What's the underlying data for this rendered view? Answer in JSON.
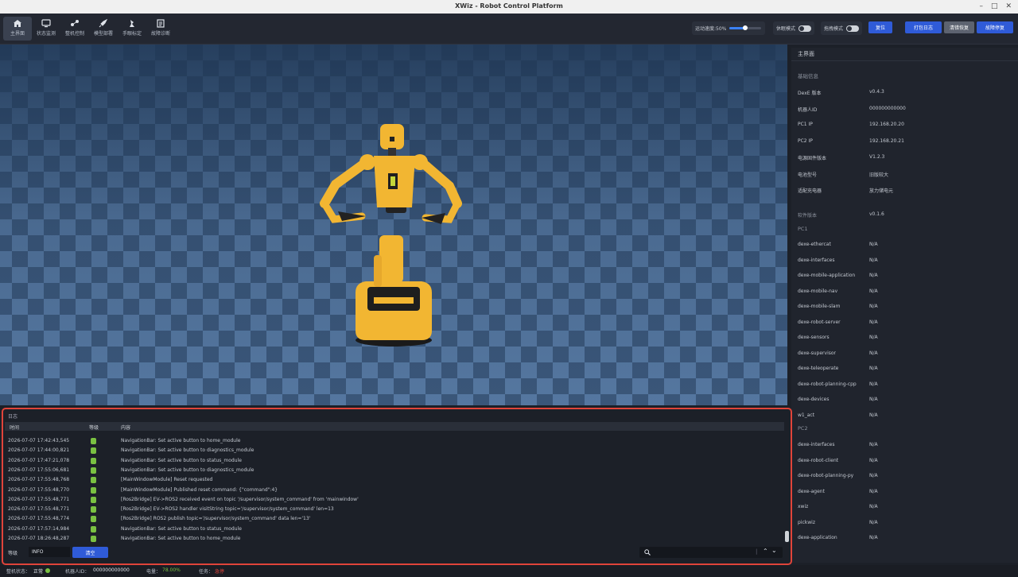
{
  "window": {
    "title": "XWiz - Robot Control Platform"
  },
  "toolbar": {
    "tabs": [
      {
        "label": "主界面",
        "icon": "home-icon"
      },
      {
        "label": "状态监测",
        "icon": "monitor-icon"
      },
      {
        "label": "整机控制",
        "icon": "control-icon"
      },
      {
        "label": "模型部署",
        "icon": "rocket-icon"
      },
      {
        "label": "手眼标定",
        "icon": "calibration-icon"
      },
      {
        "label": "故障诊断",
        "icon": "diagnostics-icon"
      }
    ],
    "speed_label": "运动速度:50%",
    "speed_value": 0.5,
    "sleep_mode_label": "休眠模式",
    "drag_mode_label": "拖拽模式",
    "reset_label": "复位",
    "pack_log_label": "打包日志",
    "clear_error_label": "清错恢复",
    "fault_stop_label": "故障停复"
  },
  "right_panel": {
    "header": "主界面",
    "basic_section": "基础信息",
    "basic": [
      {
        "k": "DexE 版本",
        "v": "v0.4.3"
      },
      {
        "k": "机器人ID",
        "v": "000000000000"
      },
      {
        "k": "PC1 IP",
        "v": "192.168.20.20"
      },
      {
        "k": "PC2 IP",
        "v": "192.168.20.21"
      },
      {
        "k": "电源固件版本",
        "v": "V1.2.3"
      },
      {
        "k": "电池型号",
        "v": "旧版较大"
      },
      {
        "k": "适配充电器",
        "v": "放力储电元"
      }
    ],
    "software_label": "软件版本",
    "software_value": "v0.1.6",
    "pc1_label": "PC1",
    "pc1": [
      {
        "k": "dexe-ethercat",
        "v": "N/A"
      },
      {
        "k": "dexe-interfaces",
        "v": "N/A"
      },
      {
        "k": "dexe-mobile-application",
        "v": "N/A"
      },
      {
        "k": "dexe-mobile-nav",
        "v": "N/A"
      },
      {
        "k": "dexe-mobile-slam",
        "v": "N/A"
      },
      {
        "k": "dexe-robot-server",
        "v": "N/A"
      },
      {
        "k": "dexe-sensors",
        "v": "N/A"
      },
      {
        "k": "dexe-supervisor",
        "v": "N/A"
      },
      {
        "k": "dexe-teleoperate",
        "v": "N/A"
      },
      {
        "k": "dexe-robot-planning-cpp",
        "v": "N/A"
      },
      {
        "k": "dexe-devices",
        "v": "N/A"
      },
      {
        "k": "w1_act",
        "v": "N/A"
      }
    ],
    "pc2_label": "PC2",
    "pc2": [
      {
        "k": "dexe-interfaces",
        "v": "N/A"
      },
      {
        "k": "dexe-robot-client",
        "v": "N/A"
      },
      {
        "k": "dexe-robot-planning-py",
        "v": "N/A"
      },
      {
        "k": "dexe-agent",
        "v": "N/A"
      },
      {
        "k": "xwiz",
        "v": "N/A"
      },
      {
        "k": "pickwiz",
        "v": "N/A"
      },
      {
        "k": "dexe-application",
        "v": "N/A"
      }
    ]
  },
  "log": {
    "title": "日志",
    "col_time": "时间",
    "col_level": "等级",
    "col_content": "内容",
    "rows": [
      {
        "time": "2026-07-07 17:42:43,545",
        "msg": "NavigationBar: Set active button to home_module"
      },
      {
        "time": "2026-07-07 17:44:00,821",
        "msg": "NavigationBar: Set active button to diagnostics_module"
      },
      {
        "time": "2026-07-07 17:47:21,078",
        "msg": "NavigationBar: Set active button to status_module"
      },
      {
        "time": "2026-07-07 17:55:06,681",
        "msg": "NavigationBar: Set active button to diagnostics_module"
      },
      {
        "time": "2026-07-07 17:55:48,768",
        "msg": "[MainWindowModule] Reset requested"
      },
      {
        "time": "2026-07-07 17:55:48,770",
        "msg": "[MainWindowModule] Published reset command: {\"command\":4}"
      },
      {
        "time": "2026-07-07 17:55:48,771",
        "msg": "[Ros2Bridge] EV->ROS2 received event on topic '/supervisor/system_command' from 'mainwindow'"
      },
      {
        "time": "2026-07-07 17:55:48,771",
        "msg": "[Ros2Bridge] EV->ROS2 handler visitString topic='/supervisor/system_command' len=13"
      },
      {
        "time": "2026-07-07 17:55:48,774",
        "msg": "[Ros2Bridge] ROS2 publish topic='/supervisor/system_command' data len='13'"
      },
      {
        "time": "2026-07-07 17:57:14,984",
        "msg": "NavigationBar: Set active button to status_module"
      },
      {
        "time": "2026-07-07 18:26:48,287",
        "msg": "NavigationBar: Set active button to home_module"
      }
    ],
    "level_label": "等级",
    "level_value": "INFO",
    "clear_label": "清空"
  },
  "status_bar": {
    "machine_label": "整机状态：",
    "machine_value": "正常",
    "robot_id_label": "机器人ID：",
    "robot_id_value": "000000000000",
    "battery_label": "电量：",
    "battery_value": "78.00%",
    "task_label": "任务：",
    "task_value": "急停"
  },
  "colors": {
    "accent": "#2f5bd8",
    "ok": "#7ac142",
    "error": "#e0443a",
    "robot": "#f2b632"
  }
}
